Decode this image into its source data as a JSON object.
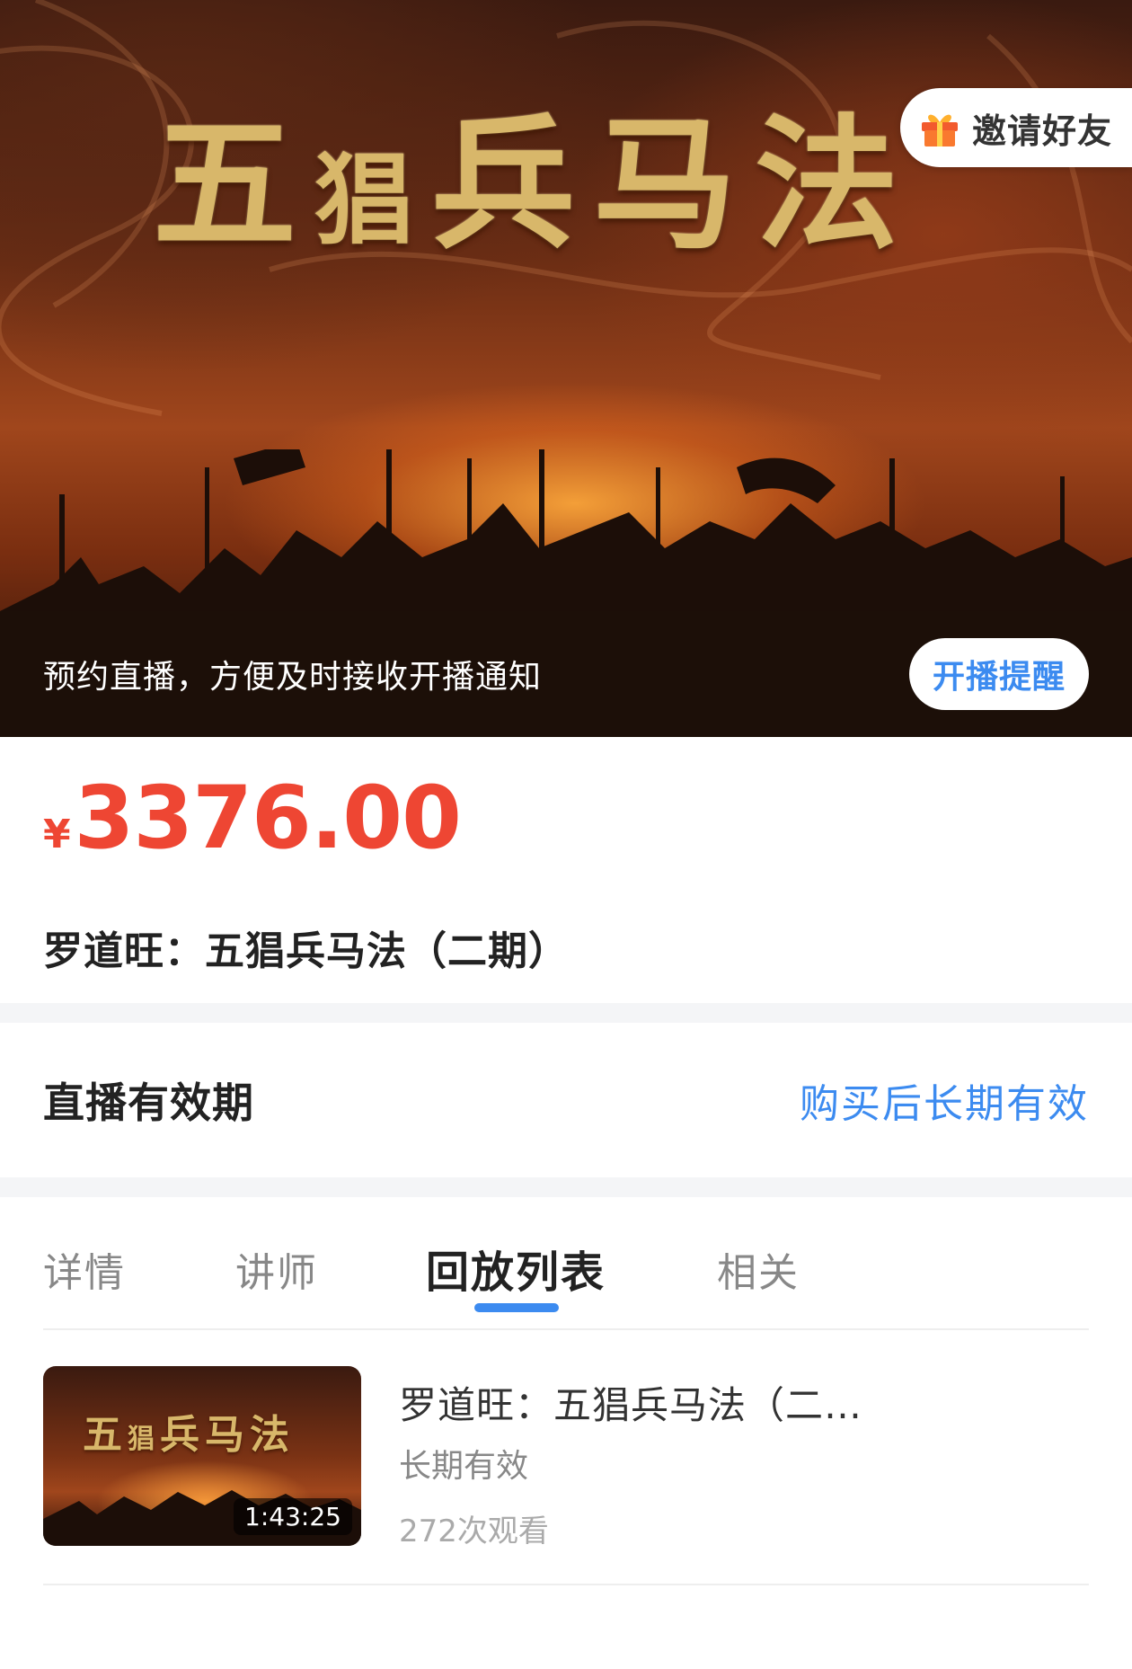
{
  "hero": {
    "title_chars": [
      "五",
      "猖",
      "兵",
      "马",
      "法"
    ],
    "invite_label": "邀请好友",
    "reserve_text": "预约直播，方便及时接收开播通知",
    "remind_button": "开播提醒"
  },
  "price": {
    "currency": "¥",
    "amount": "3376.00"
  },
  "course": {
    "title": "罗道旺：五猖兵马法（二期）"
  },
  "validity": {
    "label": "直播有效期",
    "value": "购买后长期有效"
  },
  "tabs": [
    {
      "label": "详情",
      "active": false
    },
    {
      "label": "讲师",
      "active": false
    },
    {
      "label": "回放列表",
      "active": true
    },
    {
      "label": "相关",
      "active": false
    }
  ],
  "replay_items": [
    {
      "thumb_title_chars": [
        "五",
        "猖",
        "兵",
        "马",
        "法"
      ],
      "duration": "1:43:25",
      "title": "罗道旺：五猖兵马法（二…",
      "validity": "长期有效",
      "views": "272次观看"
    }
  ],
  "colors": {
    "accent_blue": "#3c8bf0",
    "price_red": "#ee4633",
    "title_gold": "#d8b76a"
  }
}
